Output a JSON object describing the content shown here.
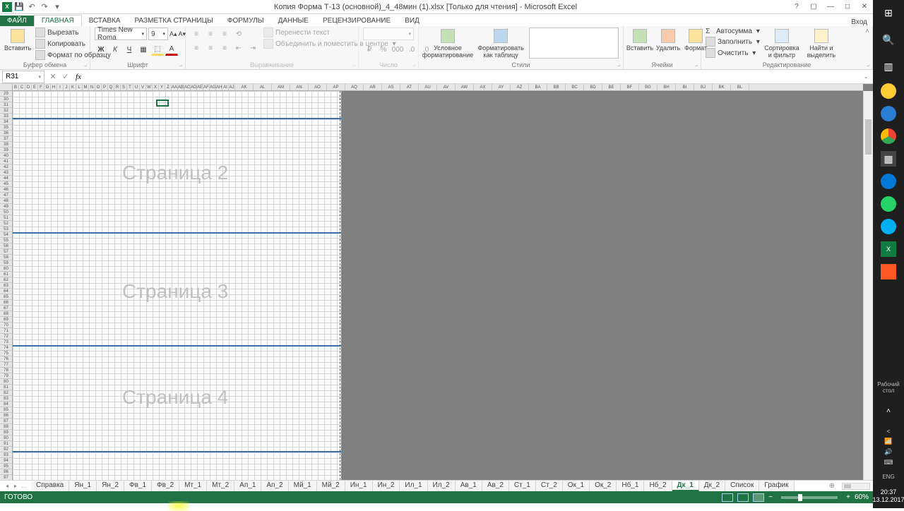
{
  "titlebar": {
    "title": "Копия Форма Т-13 (основной)_4_48мин (1).xlsx [Только для чтения] - Microsoft Excel",
    "signin": "Вход"
  },
  "tabs": {
    "file": "ФАЙЛ",
    "home": "ГЛАВНАЯ",
    "insert": "ВСТАВКА",
    "pagelayout": "РАЗМЕТКА СТРАНИЦЫ",
    "formulas": "ФОРМУЛЫ",
    "data": "ДАННЫЕ",
    "review": "РЕЦЕНЗИРОВАНИЕ",
    "view": "ВИД"
  },
  "ribbon": {
    "paste": "Вставить",
    "cut": "Вырезать",
    "copy": "Копировать",
    "formatpainter": "Формат по образцу",
    "clipboard": "Буфер обмена",
    "fontname": "Times New Roma",
    "fontsize": "9",
    "font": "Шрифт",
    "wrap": "Перенести текст",
    "merge": "Объединить и поместить в центре",
    "alignment": "Выравнивание",
    "number": "Число",
    "condfmt": "Условное форматирование",
    "fmttable": "Форматировать как таблицу",
    "styles": "Стили",
    "insertc": "Вставить",
    "deletec": "Удалить",
    "formatc": "Формат",
    "cells": "Ячейки",
    "autosum": "Автосумма",
    "fill": "Заполнить",
    "clear": "Очистить",
    "sortfilter": "Сортировка и фильтр",
    "findselect": "Найти и выделить",
    "editing": "Редактирование"
  },
  "fx": {
    "namebox": "R31",
    "formula": ""
  },
  "watermarks": {
    "p2": "Страница 2",
    "p3": "Страница 3",
    "p4": "Страница 4"
  },
  "sheets": [
    "Справка",
    "Ян_1",
    "Ян_2",
    "Фв_1",
    "Фв_2",
    "Мт_1",
    "Мт_2",
    "Ап_1",
    "Ап_2",
    "Мй_1",
    "Мй_2",
    "Ин_1",
    "Ин_2",
    "Ил_1",
    "Ил_2",
    "Ав_1",
    "Ав_2",
    "Ст_1",
    "Ст_2",
    "Ок_1",
    "Ок_2",
    "Нб_1",
    "Нб_2",
    "Дк_1",
    "Дк_2",
    "Список",
    "График"
  ],
  "sheets_active_index": 23,
  "status": {
    "ready": "ГОТОВО",
    "zoom": "60%"
  },
  "taskbar": {
    "desktop": "Рабочий стол",
    "lang": "ENG",
    "time": "20:37",
    "date": "13.12.2017"
  },
  "chart_data": null
}
